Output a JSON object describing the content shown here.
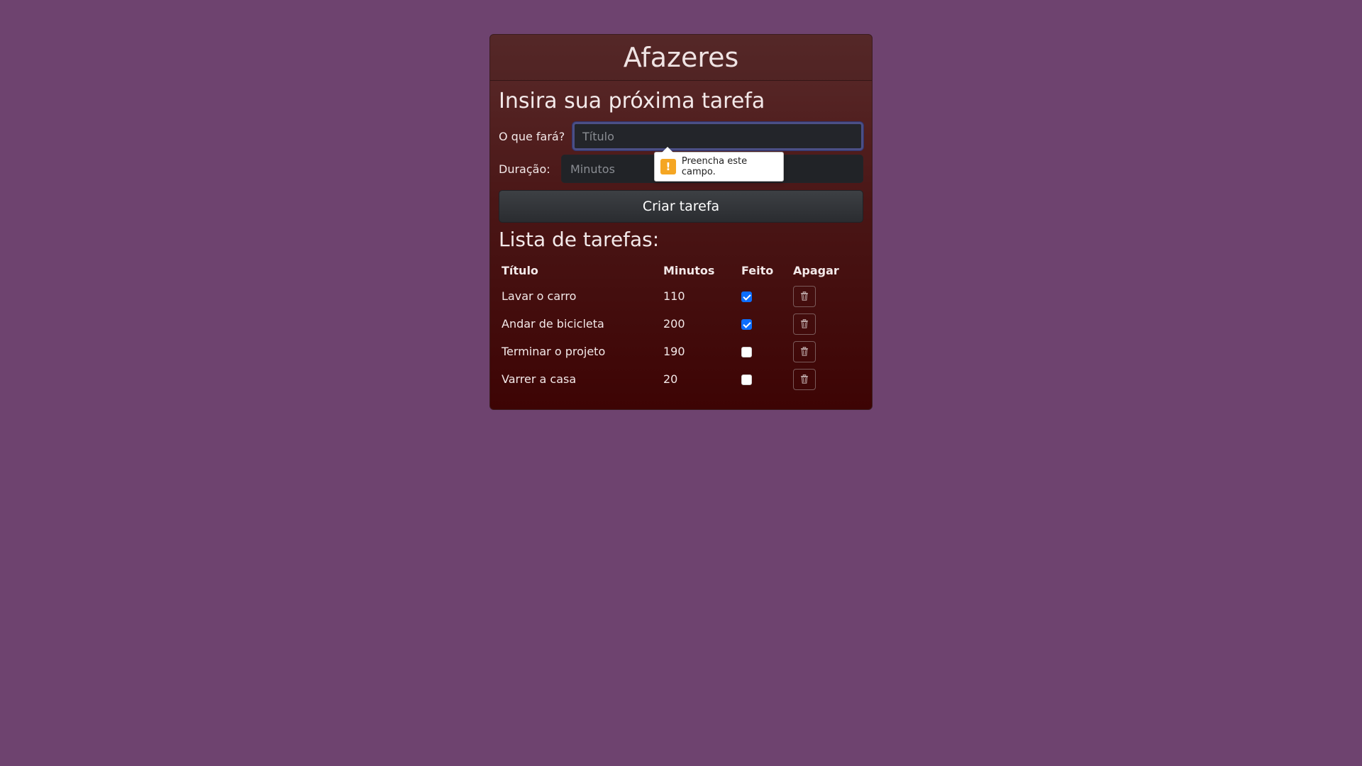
{
  "app": {
    "title": "Afazeres"
  },
  "form": {
    "heading": "Insira sua próxima tarefa",
    "title_label": "O que fará?",
    "title_placeholder": "Título",
    "duration_label": "Duração:",
    "duration_placeholder": "Minutos",
    "submit_label": "Criar tarefa"
  },
  "validation": {
    "message": "Preencha este campo.",
    "icon": "warning-icon",
    "color": "#f5a623"
  },
  "list": {
    "heading": "Lista de tarefas:",
    "columns": [
      "Título",
      "Minutos",
      "Feito",
      "Apagar"
    ],
    "rows": [
      {
        "title": "Lavar o carro",
        "minutes": "110",
        "done": true
      },
      {
        "title": "Andar de bicicleta",
        "minutes": "200",
        "done": true
      },
      {
        "title": "Terminar o projeto",
        "minutes": "190",
        "done": false
      },
      {
        "title": "Varrer a casa",
        "minutes": "20",
        "done": false
      }
    ]
  },
  "colors": {
    "background": "#6e436f",
    "checkbox_checked": "#0d6efd"
  }
}
